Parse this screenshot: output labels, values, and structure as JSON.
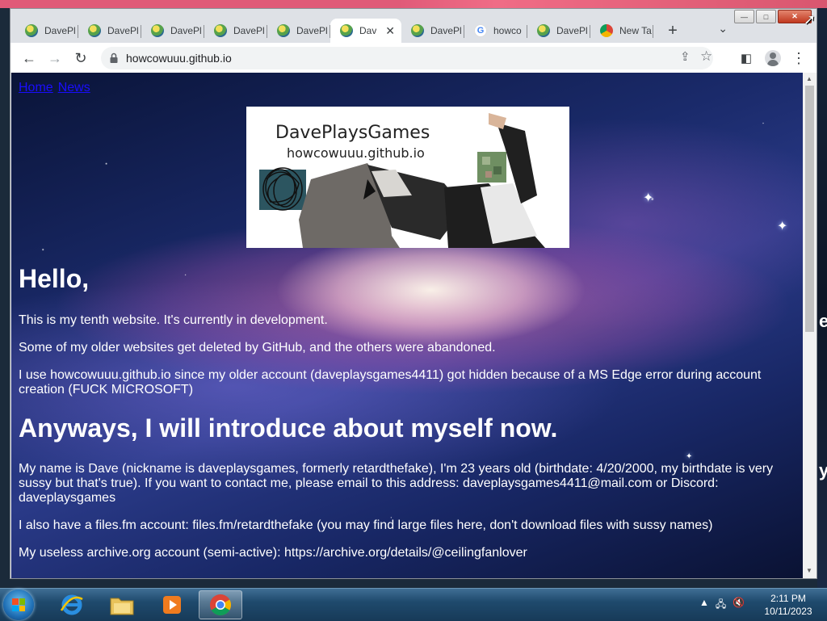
{
  "browser": {
    "tabs": [
      {
        "label": "DavePl",
        "favicon": "dpg-icon",
        "active": false
      },
      {
        "label": "DavePl",
        "favicon": "dpg-icon",
        "active": false
      },
      {
        "label": "DavePl",
        "favicon": "dpg-icon",
        "active": false
      },
      {
        "label": "DavePl",
        "favicon": "dpg-icon",
        "active": false
      },
      {
        "label": "DavePl",
        "favicon": "dpg-icon",
        "active": false
      },
      {
        "label": "Dav",
        "favicon": "dpg-icon",
        "active": true
      },
      {
        "label": "DavePl",
        "favicon": "dpg-icon",
        "active": false
      },
      {
        "label": "howco",
        "favicon": "google-icon",
        "active": false
      },
      {
        "label": "DavePl",
        "favicon": "dpg-icon",
        "active": false
      },
      {
        "label": "New Ta",
        "favicon": "chrome-icon",
        "active": false
      }
    ],
    "url": "howcowuuu.github.io",
    "caption": {
      "minimize": "—",
      "maximize": "□",
      "close": "✕"
    }
  },
  "page": {
    "nav": [
      "Home",
      "News"
    ],
    "banner": {
      "title": "DavePlaysGames",
      "subtitle": "howcowuuu.github.io"
    },
    "heading1": "Hello,",
    "paragraphs1": [
      "This is my tenth website. It's currently in development.",
      "Some of my older websites get deleted by GitHub, and the others were abandoned.",
      "I use howcowuuu.github.io since my older account (daveplaysgames4411) got hidden because of a MS Edge error during account creation (FUCK MICROSOFT)"
    ],
    "heading2": "Anyways, I will introduce about myself now.",
    "paragraphs2": [
      "My name is Dave (nickname is daveplaysgames, formerly retardthefake), I'm 23 years old (birthdate: 4/20/2000, my birthdate is very sussy but that's true). If you want to contact me, please email to this address: daveplaysgames4411@mail.com or Discord: daveplaysgames",
      "I also have a files.fm account: files.fm/retardthefake (you may find large files here, don't download files with sussy names)",
      "My useless archive.org account (semi-active): https://archive.org/details/@ceilingfanlover"
    ]
  },
  "taskbar": {
    "apps": [
      "ie-icon",
      "explorer-icon",
      "media-player-icon",
      "chrome-icon"
    ],
    "time": "2:11 PM",
    "date": "10/11/2023"
  },
  "colors": {
    "tabstrip": "#dee1e6",
    "link": "#1a0dff",
    "taskbar": "#1f4a6d"
  }
}
